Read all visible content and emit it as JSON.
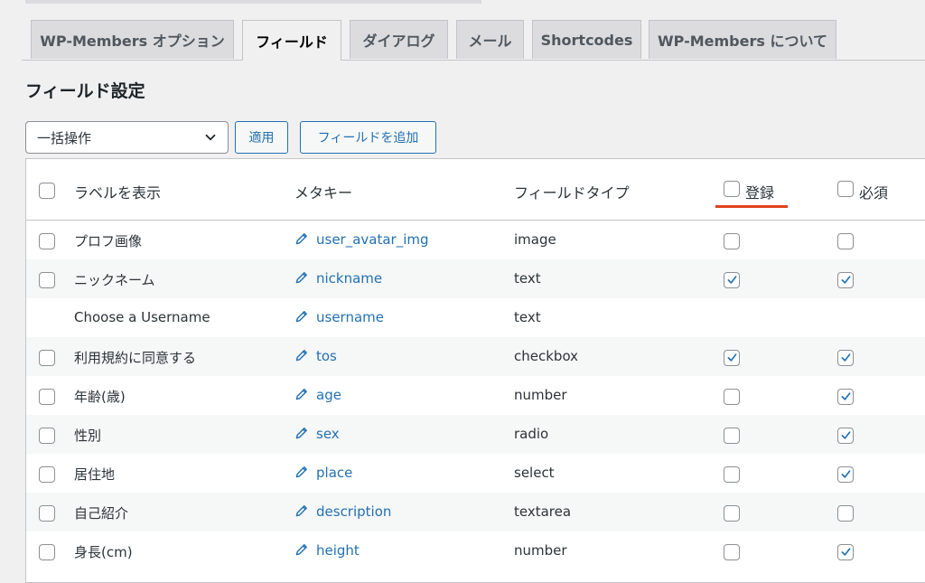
{
  "tabs": [
    {
      "label": "WP-Members オプション"
    },
    {
      "label": "フィールド"
    },
    {
      "label": "ダイアログ"
    },
    {
      "label": "メール"
    },
    {
      "label": "Shortcodes"
    },
    {
      "label": "WP-Members について"
    }
  ],
  "page_title": "フィールド設定",
  "bulk_select": {
    "value": "一括操作"
  },
  "apply_button": "適用",
  "add_field_button": "フィールドを追加",
  "columns": {
    "label": "ラベルを表示",
    "meta_key": "メタキー",
    "field_type": "フィールドタイプ",
    "register": "登録",
    "required": "必須"
  },
  "rows": [
    {
      "label": "プロフ画像",
      "meta_key": "user_avatar_img",
      "type": "image",
      "register": false,
      "required": false
    },
    {
      "label": "ニックネーム",
      "meta_key": "nickname",
      "type": "text",
      "register": true,
      "required": true
    },
    {
      "label": "Choose a Username",
      "meta_key": "username",
      "type": "text"
    },
    {
      "label": "利用規約に同意する",
      "meta_key": "tos",
      "type": "checkbox",
      "register": true,
      "required": true
    },
    {
      "label": "年齢(歳)",
      "meta_key": "age",
      "type": "number",
      "register": false,
      "required": true
    },
    {
      "label": "性別",
      "meta_key": "sex",
      "type": "radio",
      "register": false,
      "required": true
    },
    {
      "label": "居住地",
      "meta_key": "place",
      "type": "select",
      "register": false,
      "required": true
    },
    {
      "label": "自己紹介",
      "meta_key": "description",
      "type": "textarea",
      "register": false,
      "required": false
    },
    {
      "label": "身長(cm)",
      "meta_key": "height",
      "type": "number",
      "register": false,
      "required": true
    }
  ],
  "colors": {
    "accent": "#2271b1",
    "highlight_underline": "#e0401d"
  }
}
